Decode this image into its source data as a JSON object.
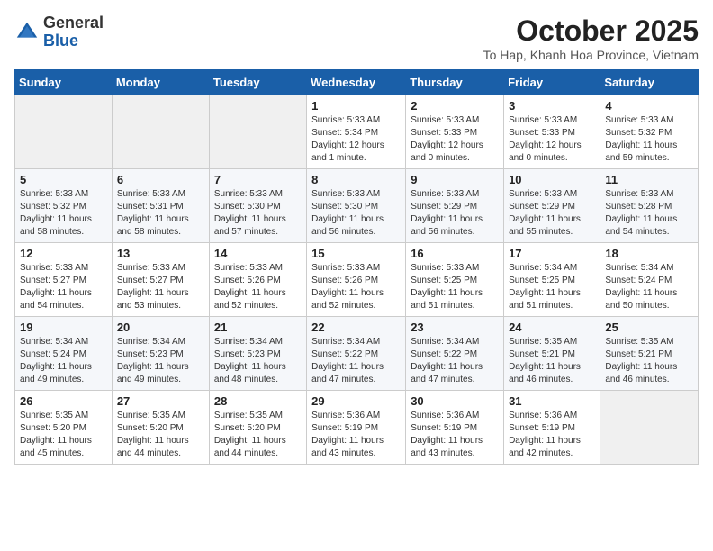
{
  "header": {
    "logo_general": "General",
    "logo_blue": "Blue",
    "month_title": "October 2025",
    "location": "To Hap, Khanh Hoa Province, Vietnam"
  },
  "weekdays": [
    "Sunday",
    "Monday",
    "Tuesday",
    "Wednesday",
    "Thursday",
    "Friday",
    "Saturday"
  ],
  "weeks": [
    [
      {
        "day": "",
        "info": ""
      },
      {
        "day": "",
        "info": ""
      },
      {
        "day": "",
        "info": ""
      },
      {
        "day": "1",
        "info": "Sunrise: 5:33 AM\nSunset: 5:34 PM\nDaylight: 12 hours and 1 minute."
      },
      {
        "day": "2",
        "info": "Sunrise: 5:33 AM\nSunset: 5:33 PM\nDaylight: 12 hours and 0 minutes."
      },
      {
        "day": "3",
        "info": "Sunrise: 5:33 AM\nSunset: 5:33 PM\nDaylight: 12 hours and 0 minutes."
      },
      {
        "day": "4",
        "info": "Sunrise: 5:33 AM\nSunset: 5:32 PM\nDaylight: 11 hours and 59 minutes."
      }
    ],
    [
      {
        "day": "5",
        "info": "Sunrise: 5:33 AM\nSunset: 5:32 PM\nDaylight: 11 hours and 58 minutes."
      },
      {
        "day": "6",
        "info": "Sunrise: 5:33 AM\nSunset: 5:31 PM\nDaylight: 11 hours and 58 minutes."
      },
      {
        "day": "7",
        "info": "Sunrise: 5:33 AM\nSunset: 5:30 PM\nDaylight: 11 hours and 57 minutes."
      },
      {
        "day": "8",
        "info": "Sunrise: 5:33 AM\nSunset: 5:30 PM\nDaylight: 11 hours and 56 minutes."
      },
      {
        "day": "9",
        "info": "Sunrise: 5:33 AM\nSunset: 5:29 PM\nDaylight: 11 hours and 56 minutes."
      },
      {
        "day": "10",
        "info": "Sunrise: 5:33 AM\nSunset: 5:29 PM\nDaylight: 11 hours and 55 minutes."
      },
      {
        "day": "11",
        "info": "Sunrise: 5:33 AM\nSunset: 5:28 PM\nDaylight: 11 hours and 54 minutes."
      }
    ],
    [
      {
        "day": "12",
        "info": "Sunrise: 5:33 AM\nSunset: 5:27 PM\nDaylight: 11 hours and 54 minutes."
      },
      {
        "day": "13",
        "info": "Sunrise: 5:33 AM\nSunset: 5:27 PM\nDaylight: 11 hours and 53 minutes."
      },
      {
        "day": "14",
        "info": "Sunrise: 5:33 AM\nSunset: 5:26 PM\nDaylight: 11 hours and 52 minutes."
      },
      {
        "day": "15",
        "info": "Sunrise: 5:33 AM\nSunset: 5:26 PM\nDaylight: 11 hours and 52 minutes."
      },
      {
        "day": "16",
        "info": "Sunrise: 5:33 AM\nSunset: 5:25 PM\nDaylight: 11 hours and 51 minutes."
      },
      {
        "day": "17",
        "info": "Sunrise: 5:34 AM\nSunset: 5:25 PM\nDaylight: 11 hours and 51 minutes."
      },
      {
        "day": "18",
        "info": "Sunrise: 5:34 AM\nSunset: 5:24 PM\nDaylight: 11 hours and 50 minutes."
      }
    ],
    [
      {
        "day": "19",
        "info": "Sunrise: 5:34 AM\nSunset: 5:24 PM\nDaylight: 11 hours and 49 minutes."
      },
      {
        "day": "20",
        "info": "Sunrise: 5:34 AM\nSunset: 5:23 PM\nDaylight: 11 hours and 49 minutes."
      },
      {
        "day": "21",
        "info": "Sunrise: 5:34 AM\nSunset: 5:23 PM\nDaylight: 11 hours and 48 minutes."
      },
      {
        "day": "22",
        "info": "Sunrise: 5:34 AM\nSunset: 5:22 PM\nDaylight: 11 hours and 47 minutes."
      },
      {
        "day": "23",
        "info": "Sunrise: 5:34 AM\nSunset: 5:22 PM\nDaylight: 11 hours and 47 minutes."
      },
      {
        "day": "24",
        "info": "Sunrise: 5:35 AM\nSunset: 5:21 PM\nDaylight: 11 hours and 46 minutes."
      },
      {
        "day": "25",
        "info": "Sunrise: 5:35 AM\nSunset: 5:21 PM\nDaylight: 11 hours and 46 minutes."
      }
    ],
    [
      {
        "day": "26",
        "info": "Sunrise: 5:35 AM\nSunset: 5:20 PM\nDaylight: 11 hours and 45 minutes."
      },
      {
        "day": "27",
        "info": "Sunrise: 5:35 AM\nSunset: 5:20 PM\nDaylight: 11 hours and 44 minutes."
      },
      {
        "day": "28",
        "info": "Sunrise: 5:35 AM\nSunset: 5:20 PM\nDaylight: 11 hours and 44 minutes."
      },
      {
        "day": "29",
        "info": "Sunrise: 5:36 AM\nSunset: 5:19 PM\nDaylight: 11 hours and 43 minutes."
      },
      {
        "day": "30",
        "info": "Sunrise: 5:36 AM\nSunset: 5:19 PM\nDaylight: 11 hours and 43 minutes."
      },
      {
        "day": "31",
        "info": "Sunrise: 5:36 AM\nSunset: 5:19 PM\nDaylight: 11 hours and 42 minutes."
      },
      {
        "day": "",
        "info": ""
      }
    ]
  ]
}
